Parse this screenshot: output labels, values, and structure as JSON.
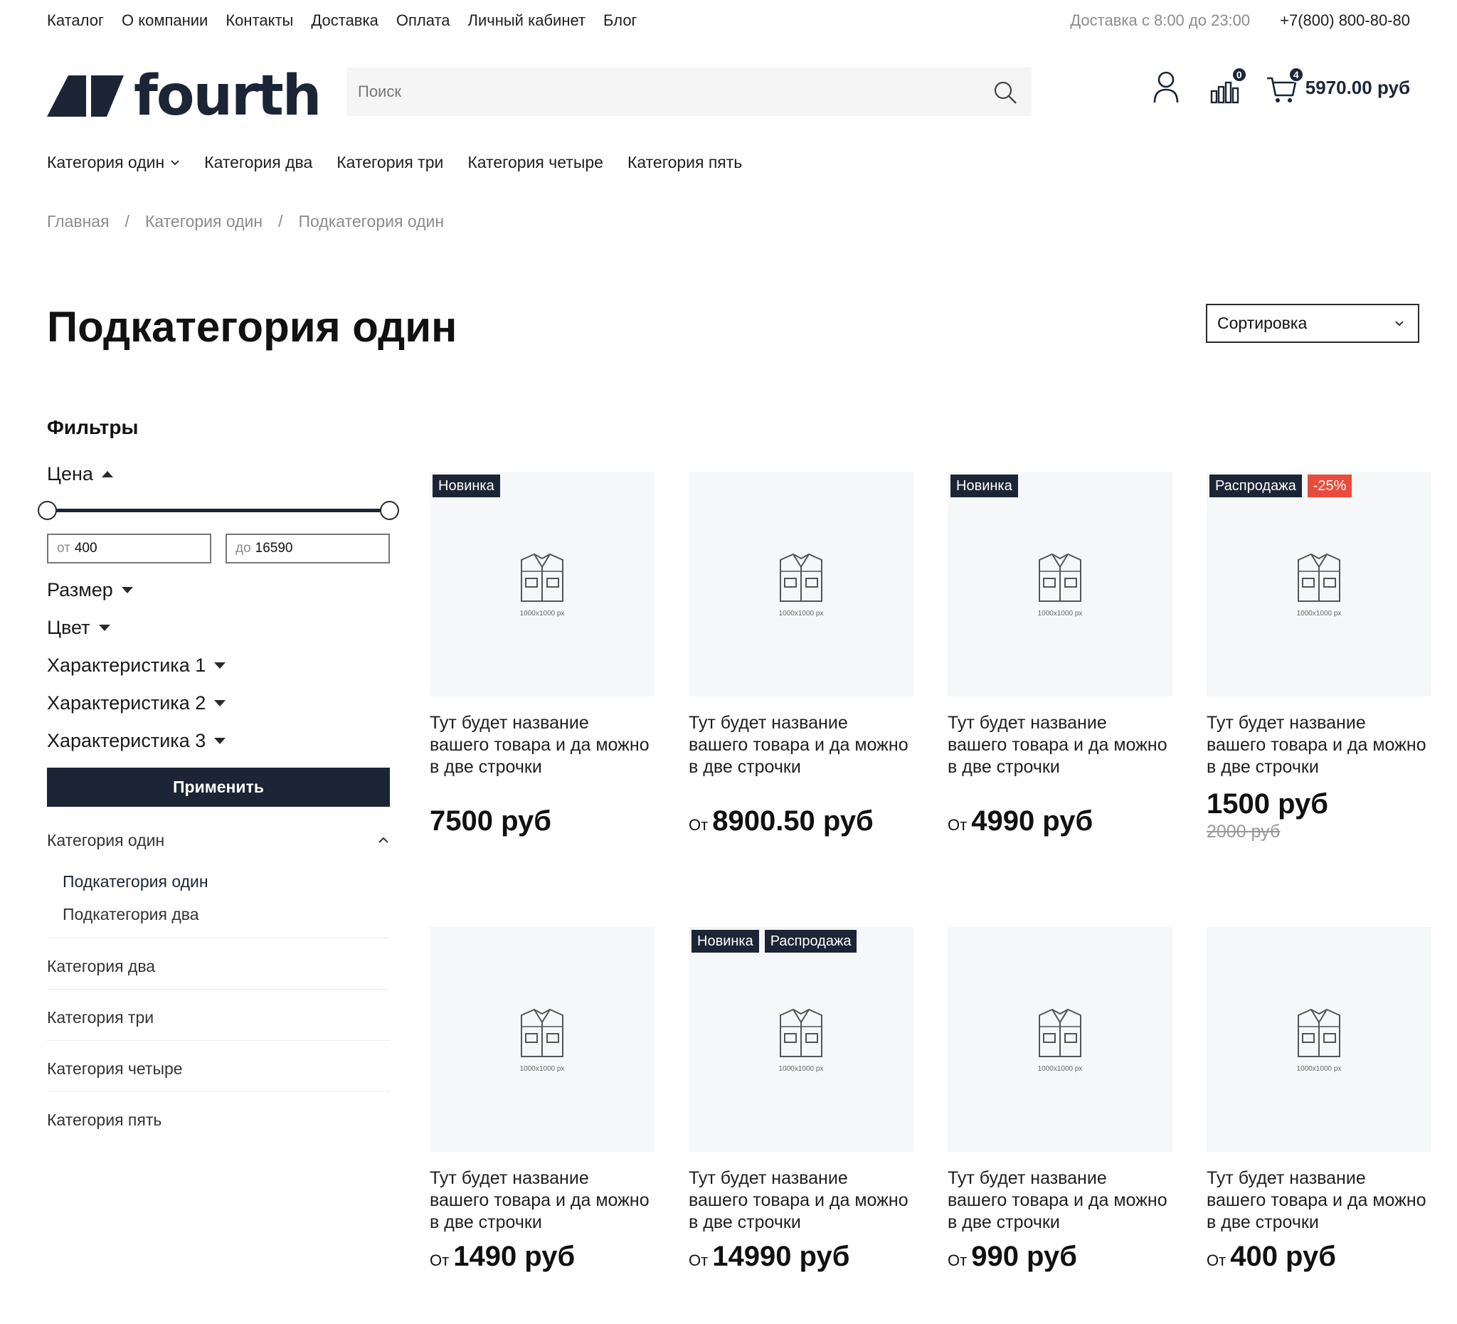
{
  "topnav": {
    "items": [
      "Каталог",
      "О компании",
      "Контакты",
      "Доставка",
      "Оплата",
      "Личный кабинет",
      "Блог"
    ],
    "delivery": "Доставка с 8:00 до 23:00",
    "phone": "+7(800) 800-80-80"
  },
  "header": {
    "logo_text": "fourth",
    "search_placeholder": "Поиск",
    "compare_count": "0",
    "cart_count": "4",
    "cart_total": "5970.00 руб"
  },
  "catnav": [
    "Категория один",
    "Категория два",
    "Категория три",
    "Категория четыре",
    "Категория пять"
  ],
  "breadcrumb": [
    "Главная",
    "/",
    "Категория один",
    "/",
    "Подкатегория один"
  ],
  "page": {
    "title": "Подкатегория один",
    "sort_label": "Сортировка"
  },
  "filters": {
    "title": "Фильтры",
    "price_label": "Цена",
    "price_from_label": "от",
    "price_from": "400",
    "price_to_label": "до",
    "price_to": "16590",
    "groups": [
      "Размер",
      "Цвет",
      "Характеристика 1",
      "Характеристика 2",
      "Характеристика 3"
    ],
    "apply_label": "Применить",
    "categories": {
      "open": "Категория один",
      "subs": [
        "Подкатегория один",
        "Подкатегория два"
      ],
      "others": [
        "Категория два",
        "Категория три",
        "Категория четыре",
        "Категория пять"
      ]
    }
  },
  "products": [
    {
      "tags": [
        "Новинка"
      ],
      "sale_tag": "",
      "name": "Тут будет название вашего товара и да можно в две строчки",
      "from": "",
      "price": "7500 руб",
      "old_price": "",
      "img_label": "1000x1000 px"
    },
    {
      "tags": [],
      "sale_tag": "",
      "name": "Тут будет название вашего товара и да можно в две строчки",
      "from": "От",
      "price": "8900.50 руб",
      "old_price": "",
      "img_label": "1000x1000 px"
    },
    {
      "tags": [
        "Новинка"
      ],
      "sale_tag": "",
      "name": "Тут будет название вашего товара и да можно в две строчки",
      "from": "От",
      "price": "4990 руб",
      "old_price": "",
      "img_label": "1000x1000 px"
    },
    {
      "tags": [
        "Распродажа"
      ],
      "sale_tag": "-25%",
      "name": "Тут будет название вашего товара и да можно в две строчки",
      "from": "",
      "price": "1500 руб",
      "old_price": "2000 руб",
      "img_label": "1000x1000 px"
    },
    {
      "tags": [],
      "sale_tag": "",
      "name": "Тут будет название вашего товара и да можно в две строчки",
      "from": "От",
      "price": "1490 руб",
      "old_price": "",
      "img_label": "1000x1000 px"
    },
    {
      "tags": [
        "Новинка",
        "Распродажа"
      ],
      "sale_tag": "",
      "name": "Тут будет название вашего товара и да можно в две строчки",
      "from": "От",
      "price": "14990 руб",
      "old_price": "",
      "img_label": "1000x1000 px"
    },
    {
      "tags": [],
      "sale_tag": "",
      "name": "Тут будет название вашего товара и да можно в две строчки",
      "from": "От",
      "price": "990 руб",
      "old_price": "",
      "img_label": "1000x1000 px"
    },
    {
      "tags": [],
      "sale_tag": "",
      "name": "Тут будет название вашего товара и да можно в две строчки",
      "from": "От",
      "price": "400 руб",
      "old_price": "",
      "img_label": "1000x1000 px"
    }
  ],
  "colors": {
    "brand": "#1c2535",
    "sale": "#e74c3c",
    "image_bg": "#f5f7f8"
  },
  "icons": [
    "search-icon",
    "user-icon",
    "compare-icon",
    "cart-icon",
    "chevron-down-icon",
    "shirt-icon"
  ]
}
